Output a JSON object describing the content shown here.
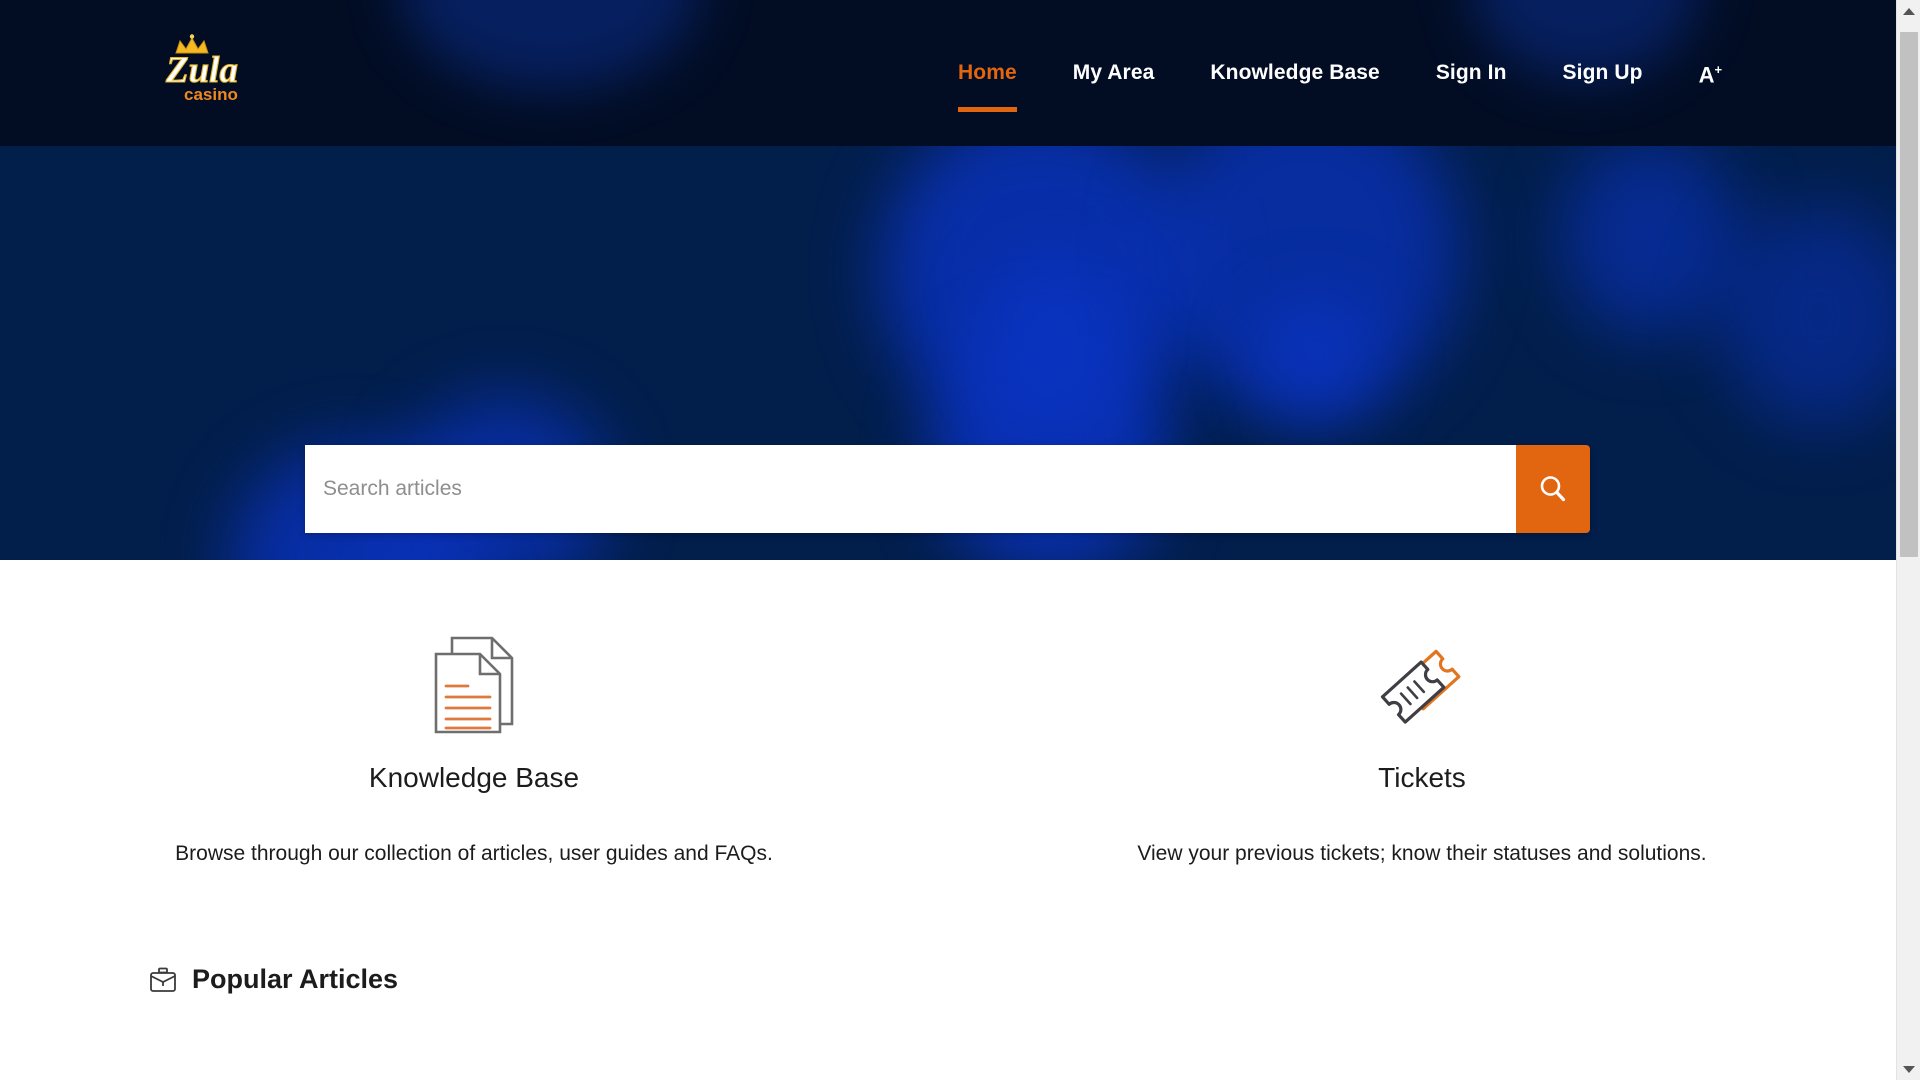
{
  "site": {
    "logo_primary": "Zula",
    "logo_secondary": "casino"
  },
  "header": {
    "nav": [
      {
        "label": "Home",
        "active": true
      },
      {
        "label": "My Area",
        "active": false
      },
      {
        "label": "Knowledge Base",
        "active": false
      },
      {
        "label": "Sign In",
        "active": false
      },
      {
        "label": "Sign Up",
        "active": false
      }
    ],
    "accessibility_label": "A",
    "accessibility_sup": "+",
    "background_color": "#020d24",
    "active_color": "#e2650f"
  },
  "hero": {
    "background_color": "#021e4b",
    "blob_color": "#0a33c0",
    "search": {
      "placeholder": "Search articles",
      "value": "",
      "button_icon": "search-icon",
      "button_color": "#e2650f"
    }
  },
  "main": {
    "cards": [
      {
        "icon": "documents-icon",
        "title": "Knowledge Base",
        "description": "Browse through our collection of articles, user guides and FAQs."
      },
      {
        "icon": "tickets-icon",
        "title": "Tickets",
        "description": "View your previous tickets; know their statuses and solutions."
      }
    ],
    "popular_section": {
      "icon": "briefcase-icon",
      "title": "Popular Articles"
    }
  },
  "scrollbar": {
    "up_arrow": "scroll-up-arrow",
    "down_arrow": "scroll-down-arrow"
  }
}
